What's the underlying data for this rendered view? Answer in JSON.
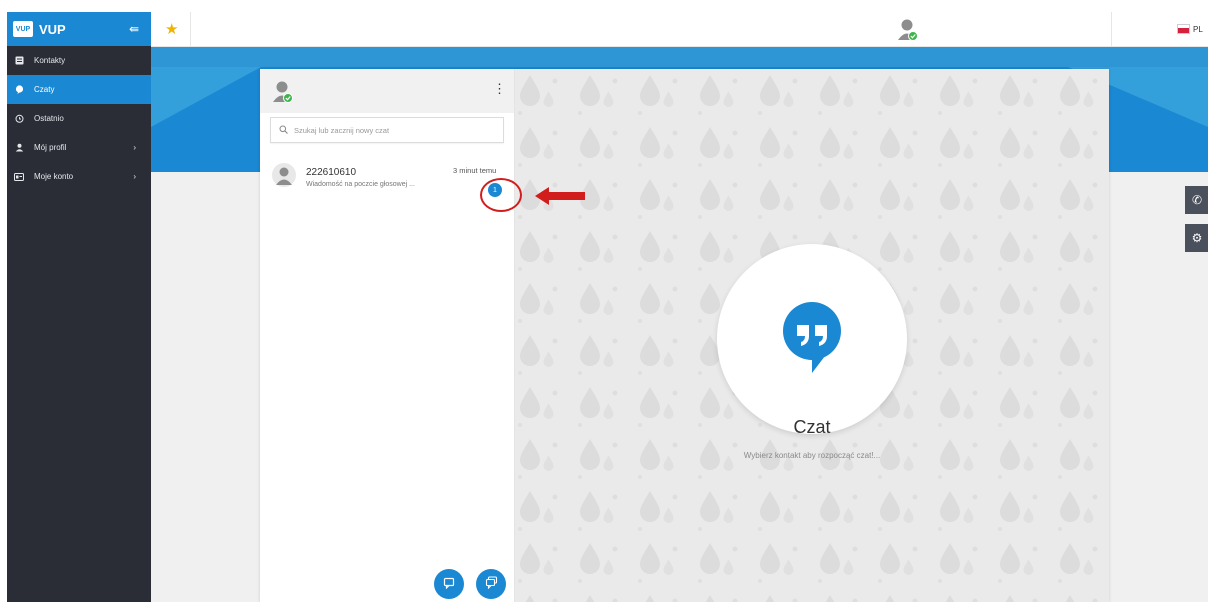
{
  "brand": {
    "logo_text": "VUP",
    "name": "VUP"
  },
  "sidebar": {
    "items": [
      {
        "label": "Kontakty",
        "icon": "contacts-icon",
        "active": false,
        "has_submenu": false
      },
      {
        "label": "Czaty",
        "icon": "chat-icon",
        "active": true,
        "has_submenu": false
      },
      {
        "label": "Ostatnio",
        "icon": "clock-icon",
        "active": false,
        "has_submenu": false
      },
      {
        "label": "Mój profil",
        "icon": "user-icon",
        "active": false,
        "has_submenu": true
      },
      {
        "label": "Moje konto",
        "icon": "account-card-icon",
        "active": false,
        "has_submenu": true
      }
    ]
  },
  "topbar": {
    "language": "PL"
  },
  "chat_list": {
    "search_placeholder": "Szukaj lub zacznij nowy czat",
    "conversations": [
      {
        "name": "222610610",
        "time": "3 minut temu",
        "preview": "Wiadomość na poczcie głosowej ...",
        "unread": "1"
      }
    ]
  },
  "welcome": {
    "title": "Czat",
    "subtitle": "Wybierz kontakt aby rozpocząć czat!..."
  },
  "colors": {
    "accent": "#1a88d2",
    "sidebar_bg": "#2a2d36",
    "annotation": "#d21d1d",
    "star": "#f0b400",
    "online_badge": "#3cb54a"
  }
}
